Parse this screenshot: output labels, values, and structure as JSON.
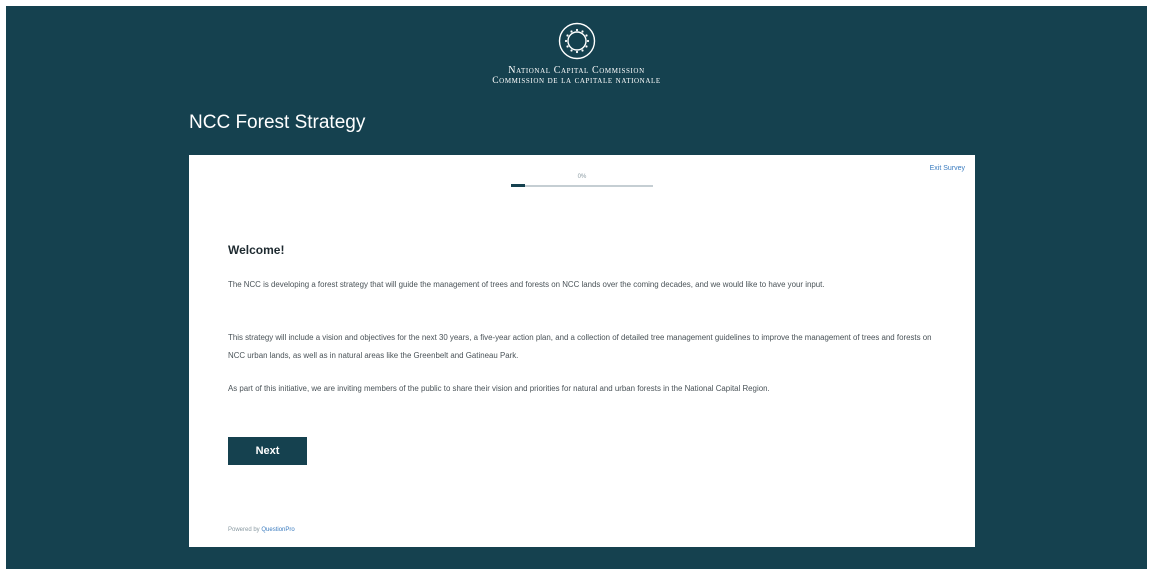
{
  "header": {
    "org_name_en": "National Capital Commission",
    "org_name_fr": "Commission de la capitale nationale",
    "page_title": "NCC Forest Strategy"
  },
  "survey": {
    "exit_label": "Exit Survey",
    "progress_percent": 0,
    "progress_label": "0%",
    "heading": "Welcome!",
    "paragraphs": [
      "The NCC is developing a forest strategy that will guide the management of trees and forests on NCC lands over the coming decades, and we would like to have your input.",
      "This strategy will include a vision and objectives for the next 30 years, a five-year action plan, and a collection of detailed tree management guidelines to improve the management of trees and forests on NCC urban lands, as well as in natural areas like the Greenbelt and Gatineau Park.",
      "As part of this initiative, we are inviting members of the public to share their vision and priorities for natural and urban forests in the National Capital Region."
    ],
    "next_label": "Next",
    "powered_by_prefix": "Powered by",
    "powered_by_brand": "QuestionPro"
  },
  "colors": {
    "background": "#15414f",
    "card": "#ffffff",
    "accent": "#15414f",
    "link": "#3a7bbf"
  },
  "icons": {
    "logo": "ncc-seal-icon"
  }
}
